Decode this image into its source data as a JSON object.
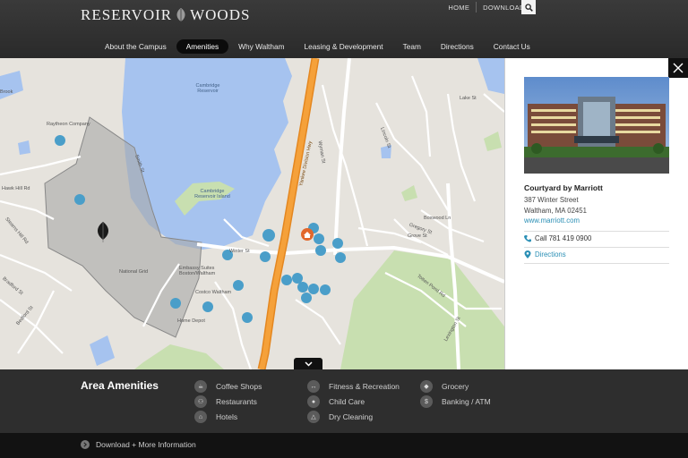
{
  "header": {
    "logo_left": "RESERVOIR",
    "logo_right": "WOODS",
    "util_links": [
      "HOME",
      "DOWNLOADS"
    ],
    "nav": [
      {
        "label": "About the Campus",
        "active": false
      },
      {
        "label": "Amenities",
        "active": true
      },
      {
        "label": "Why Waltham",
        "active": false
      },
      {
        "label": "Leasing & Development",
        "active": false
      },
      {
        "label": "Team",
        "active": false
      },
      {
        "label": "Directions",
        "active": false
      },
      {
        "label": "Contact Us",
        "active": false
      }
    ]
  },
  "map": {
    "water_labels": [
      "Cambridge Reservoir",
      "Cambridge Reservoir Island"
    ],
    "place_labels": [
      "Raytheon Company",
      "Embassy Suites Boston/Waltham",
      "Costco Waltham",
      "Home Depot",
      "National Grid",
      "Winter St",
      "Totten Pond Rd",
      "Lincoln St",
      "Wyman St",
      "Hawk Hill Rd",
      "Bedford St",
      "Stearns Hill Rd",
      "Lake St",
      "Smith St",
      "Bradford St",
      "Lexington St",
      "Grove St",
      "Boxwood Ln",
      "Gregory St",
      "Brook",
      "Yankee Division Hwy"
    ]
  },
  "panel": {
    "name": "Courtyard by Marriott",
    "address_line1": "387 Winter Street",
    "address_line2": "Waltham, MA 02451",
    "url": "www.marriott.com",
    "call": "Call 781 419 0900",
    "directions": "Directions"
  },
  "amenities": {
    "title": "Area Amenities",
    "items": [
      {
        "label": "Coffee Shops",
        "icon": "coffee-icon"
      },
      {
        "label": "Restaurants",
        "icon": "restaurant-icon"
      },
      {
        "label": "Hotels",
        "icon": "hotel-icon"
      },
      {
        "label": "Fitness & Recreation",
        "icon": "fitness-icon"
      },
      {
        "label": "Child Care",
        "icon": "child-care-icon"
      },
      {
        "label": "Dry Cleaning",
        "icon": "hanger-icon"
      },
      {
        "label": "Grocery",
        "icon": "grocery-icon"
      },
      {
        "label": "Banking / ATM",
        "icon": "dollar-icon"
      }
    ]
  },
  "footer": {
    "download": "Download + More Information"
  },
  "colors": {
    "accent": "#2a8fb5",
    "pin": "#4a9ec9",
    "highway": "#f19a2e",
    "water": "#a6c3ef",
    "park": "#c8dfb0"
  }
}
